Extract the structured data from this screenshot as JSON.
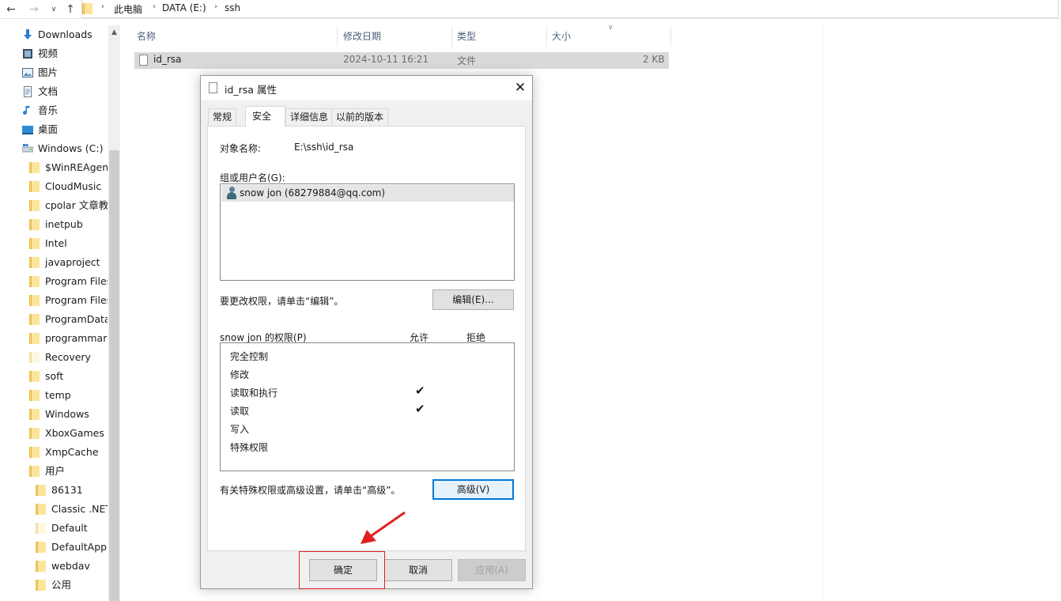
{
  "addressbar": {
    "crumbs": [
      "此电脑",
      "DATA (E:)",
      "ssh"
    ]
  },
  "navpane": {
    "quick_items": [
      {
        "label": "Downloads",
        "icon": "download-arrow-icon"
      },
      {
        "label": "视频",
        "icon": "video-icon"
      },
      {
        "label": "图片",
        "icon": "picture-icon"
      },
      {
        "label": "文档",
        "icon": "document-icon"
      },
      {
        "label": "音乐",
        "icon": "music-note-icon"
      },
      {
        "label": "桌面",
        "icon": "desktop-icon"
      }
    ],
    "drive": {
      "label": "Windows (C:)",
      "icon": "drive-icon"
    },
    "folders": [
      "$WinREAgent",
      "CloudMusic",
      "cpolar 文章教",
      "inetpub",
      "Intel",
      "javaproject",
      "Program Files",
      "Program Files",
      "ProgramData",
      "programmarS",
      "Recovery",
      "soft",
      "temp",
      "Windows",
      "XboxGames",
      "XmpCache",
      "用户"
    ],
    "subfolders": [
      "86131",
      "Classic .NET",
      "Default",
      "DefaultAppP",
      "webdav",
      "公用"
    ]
  },
  "filelist": {
    "columns": [
      "名称",
      "修改日期",
      "类型",
      "大小"
    ],
    "rows": [
      {
        "name": "id_rsa",
        "date": "2024-10-11 16:21",
        "type": "文件",
        "size": "2 KB"
      }
    ]
  },
  "dialog": {
    "title": "id_rsa 属性",
    "tabs": [
      "常规",
      "安全",
      "详细信息",
      "以前的版本"
    ],
    "active_tab": "安全",
    "object_label": "对象名称:",
    "object_value": "E:\\ssh\\id_rsa",
    "group_label": "组或用户名(G):",
    "users": [
      "snow jon (68279884@qq.com)"
    ],
    "change_hint": "要更改权限，请单击“编辑”。",
    "edit_button": "编辑(E)...",
    "perm_label": "snow jon 的权限(P)",
    "allow_header": "允许",
    "deny_header": "拒绝",
    "permissions": [
      {
        "name": "完全控制",
        "allow": false,
        "deny": false
      },
      {
        "name": "修改",
        "allow": false,
        "deny": false
      },
      {
        "name": "读取和执行",
        "allow": true,
        "deny": false
      },
      {
        "name": "读取",
        "allow": true,
        "deny": false
      },
      {
        "name": "写入",
        "allow": false,
        "deny": false
      },
      {
        "name": "特殊权限",
        "allow": false,
        "deny": false
      }
    ],
    "advanced_hint": "有关特殊权限或高级设置，请单击“高级”。",
    "advanced_button": "高级(V)",
    "ok_button": "确定",
    "cancel_button": "取消",
    "apply_button": "应用(A)",
    "check_glyph": "✔"
  },
  "colors": {
    "highlight": "#e02020",
    "accent": "#0078d7"
  }
}
